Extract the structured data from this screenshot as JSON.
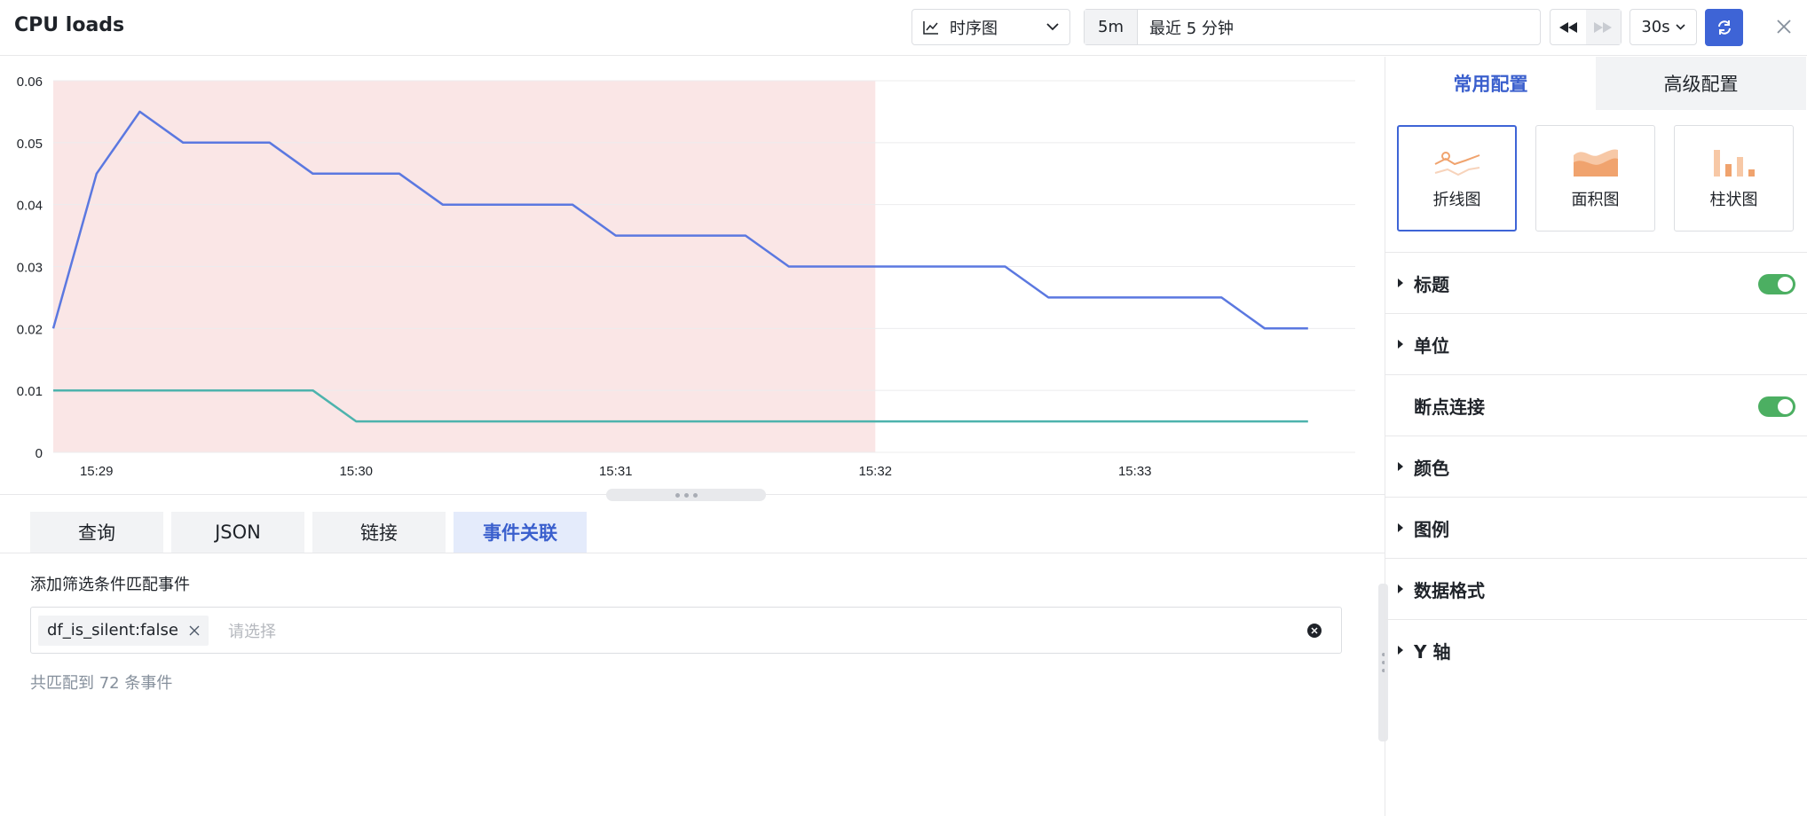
{
  "header": {
    "title": "CPU loads",
    "chart_type_label": "时序图",
    "time_short": "5m",
    "time_long": "最近 5 分钟",
    "refresh_interval": "30s"
  },
  "chart_data": {
    "type": "line",
    "x_ticks": [
      "15:29",
      "15:30",
      "15:31",
      "15:32",
      "15:33"
    ],
    "y_ticks": [
      "0.06",
      "0.05",
      "0.04",
      "0.03",
      "0.02",
      "0.01",
      "0"
    ],
    "ylim": [
      0,
      0.06
    ],
    "highlight_range": [
      "15:28:50",
      "15:32:00"
    ],
    "series": [
      {
        "color": "#5b78e0",
        "points": [
          [
            "15:28:50",
            0.02
          ],
          [
            "15:29:00",
            0.045
          ],
          [
            "15:29:10",
            0.055
          ],
          [
            "15:29:20",
            0.05
          ],
          [
            "15:29:30",
            0.05
          ],
          [
            "15:29:40",
            0.05
          ],
          [
            "15:29:50",
            0.045
          ],
          [
            "15:30:00",
            0.045
          ],
          [
            "15:30:10",
            0.045
          ],
          [
            "15:30:20",
            0.04
          ],
          [
            "15:30:30",
            0.04
          ],
          [
            "15:30:40",
            0.04
          ],
          [
            "15:30:50",
            0.04
          ],
          [
            "15:31:00",
            0.035
          ],
          [
            "15:31:10",
            0.035
          ],
          [
            "15:31:20",
            0.035
          ],
          [
            "15:31:30",
            0.035
          ],
          [
            "15:31:40",
            0.03
          ],
          [
            "15:31:50",
            0.03
          ],
          [
            "15:32:00",
            0.03
          ],
          [
            "15:32:10",
            0.03
          ],
          [
            "15:32:20",
            0.03
          ],
          [
            "15:32:30",
            0.03
          ],
          [
            "15:32:40",
            0.025
          ],
          [
            "15:32:50",
            0.025
          ],
          [
            "15:33:00",
            0.025
          ],
          [
            "15:33:10",
            0.025
          ],
          [
            "15:33:20",
            0.025
          ],
          [
            "15:33:30",
            0.02
          ],
          [
            "15:33:40",
            0.02
          ]
        ]
      },
      {
        "color": "#4db3ad",
        "points": [
          [
            "15:28:50",
            0.01
          ],
          [
            "15:29:00",
            0.01
          ],
          [
            "15:29:10",
            0.01
          ],
          [
            "15:29:20",
            0.01
          ],
          [
            "15:29:30",
            0.01
          ],
          [
            "15:29:40",
            0.01
          ],
          [
            "15:29:50",
            0.01
          ],
          [
            "15:30:00",
            0.005
          ],
          [
            "15:30:10",
            0.005
          ],
          [
            "15:30:20",
            0.005
          ],
          [
            "15:30:30",
            0.005
          ],
          [
            "15:30:40",
            0.005
          ],
          [
            "15:30:50",
            0.005
          ],
          [
            "15:31:00",
            0.005
          ],
          [
            "15:31:10",
            0.005
          ],
          [
            "15:31:20",
            0.005
          ],
          [
            "15:31:30",
            0.005
          ],
          [
            "15:31:40",
            0.005
          ],
          [
            "15:31:50",
            0.005
          ],
          [
            "15:32:00",
            0.005
          ],
          [
            "15:32:10",
            0.005
          ],
          [
            "15:32:20",
            0.005
          ],
          [
            "15:32:30",
            0.005
          ],
          [
            "15:32:40",
            0.005
          ],
          [
            "15:32:50",
            0.005
          ],
          [
            "15:33:00",
            0.005
          ],
          [
            "15:33:10",
            0.005
          ],
          [
            "15:33:20",
            0.005
          ],
          [
            "15:33:30",
            0.005
          ],
          [
            "15:33:40",
            0.005
          ]
        ]
      }
    ],
    "grid": true,
    "highlight_color": "#fae6e6"
  },
  "query_tabs": [
    {
      "label": "查询",
      "active": false
    },
    {
      "label": "JSON",
      "active": false
    },
    {
      "label": "链接",
      "active": false
    },
    {
      "label": "事件关联",
      "active": true
    }
  ],
  "event_filter": {
    "label": "添加筛选条件匹配事件",
    "tag": "df_is_silent:false",
    "placeholder": "请选择",
    "match_count": "共匹配到 72 条事件"
  },
  "side_panel": {
    "tabs": [
      {
        "label": "常用配置",
        "active": true
      },
      {
        "label": "高级配置",
        "active": false
      }
    ],
    "chart_types": [
      {
        "label": "折线图",
        "icon": "line-chart-icon",
        "active": true
      },
      {
        "label": "面积图",
        "icon": "area-chart-icon",
        "active": false
      },
      {
        "label": "柱状图",
        "icon": "bar-chart-icon",
        "active": false
      }
    ],
    "config_items": [
      {
        "label": "标题",
        "expandable": true,
        "toggle": true
      },
      {
        "label": "单位",
        "expandable": true,
        "toggle": false
      },
      {
        "label": "断点连接",
        "expandable": false,
        "toggle": true
      },
      {
        "label": "颜色",
        "expandable": true,
        "toggle": false
      },
      {
        "label": "图例",
        "expandable": true,
        "toggle": false
      },
      {
        "label": "数据格式",
        "expandable": true,
        "toggle": false
      },
      {
        "label": "Y 轴",
        "expandable": true,
        "toggle": false
      }
    ]
  },
  "colors": {
    "accent": "#3e64d6",
    "toggle_on": "#4caf62",
    "orange": "#f0a36e"
  }
}
